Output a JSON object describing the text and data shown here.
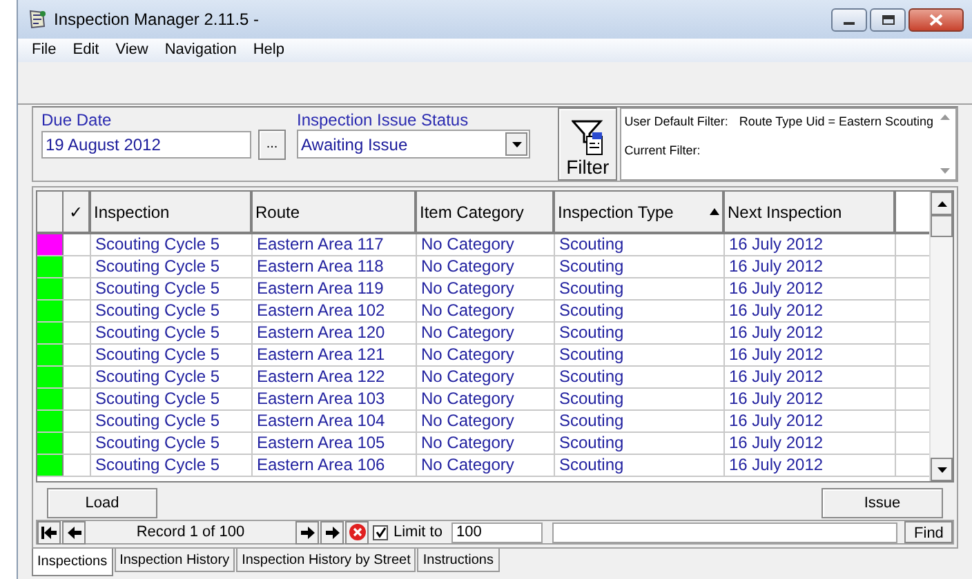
{
  "window": {
    "title": "Inspection Manager 2.11.5 -"
  },
  "menu": [
    "File",
    "Edit",
    "View",
    "Navigation",
    "Help"
  ],
  "filters": {
    "due_date": {
      "label": "Due Date",
      "value": "19 August 2012",
      "button": "..."
    },
    "status": {
      "label": "Inspection Issue Status",
      "value": "Awaiting Issue"
    },
    "filter_button": "Filter",
    "summary": [
      {
        "label": "User Default Filter:",
        "value": "Route Type Uid = Eastern Scouting"
      },
      {
        "label": "Current Filter:"
      }
    ]
  },
  "table": {
    "columns": [
      {
        "label": "✓"
      },
      {
        "label": "Inspection"
      },
      {
        "label": "Route"
      },
      {
        "label": "Item Category"
      },
      {
        "label": "Inspection Type",
        "sorted": true
      },
      {
        "label": "Next Inspection"
      }
    ],
    "rows": [
      {
        "color": "#ff00ff",
        "cells": [
          "",
          "Scouting Cycle 5",
          "Eastern Area 117",
          "No Category",
          "Scouting",
          "16 July 2012"
        ]
      },
      {
        "color": "#00ff00",
        "cells": [
          "",
          "Scouting Cycle 5",
          "Eastern Area 118",
          "No Category",
          "Scouting",
          "16 July 2012"
        ]
      },
      {
        "color": "#00ff00",
        "cells": [
          "",
          "Scouting Cycle 5",
          "Eastern Area 119",
          "No Category",
          "Scouting",
          "16 July 2012"
        ]
      },
      {
        "color": "#00ff00",
        "cells": [
          "",
          "Scouting Cycle 5",
          "Eastern Area 102",
          "No Category",
          "Scouting",
          "16 July 2012"
        ]
      },
      {
        "color": "#00ff00",
        "cells": [
          "",
          "Scouting Cycle 5",
          "Eastern Area 120",
          "No Category",
          "Scouting",
          "16 July 2012"
        ]
      },
      {
        "color": "#00ff00",
        "cells": [
          "",
          "Scouting Cycle 5",
          "Eastern Area 121",
          "No Category",
          "Scouting",
          "16 July 2012"
        ]
      },
      {
        "color": "#00ff00",
        "cells": [
          "",
          "Scouting Cycle 5",
          "Eastern Area 122",
          "No Category",
          "Scouting",
          "16 July 2012"
        ]
      },
      {
        "color": "#00ff00",
        "cells": [
          "",
          "Scouting Cycle 5",
          "Eastern Area 103",
          "No Category",
          "Scouting",
          "16 July 2012"
        ]
      },
      {
        "color": "#00ff00",
        "cells": [
          "",
          "Scouting Cycle 5",
          "Eastern Area 104",
          "No Category",
          "Scouting",
          "16 July 2012"
        ]
      },
      {
        "color": "#00ff00",
        "cells": [
          "",
          "Scouting Cycle 5",
          "Eastern Area 105",
          "No Category",
          "Scouting",
          "16 July 2012"
        ]
      },
      {
        "color": "#00ff00",
        "cells": [
          "",
          "Scouting Cycle 5",
          "Eastern Area 106",
          "No Category",
          "Scouting",
          "16 July 2012"
        ]
      }
    ]
  },
  "actions": {
    "load": "Load",
    "issue": "Issue"
  },
  "navigator": {
    "record": "Record 1 of 100",
    "limit_checked": true,
    "limit_label": "Limit to",
    "limit_value": "100",
    "find": "Find"
  },
  "tabs": [
    {
      "label": "Inspections",
      "selected": true
    },
    {
      "label": "Inspection History",
      "selected": false
    },
    {
      "label": "Inspection History by Street",
      "selected": false
    },
    {
      "label": "Instructions",
      "selected": false
    }
  ]
}
